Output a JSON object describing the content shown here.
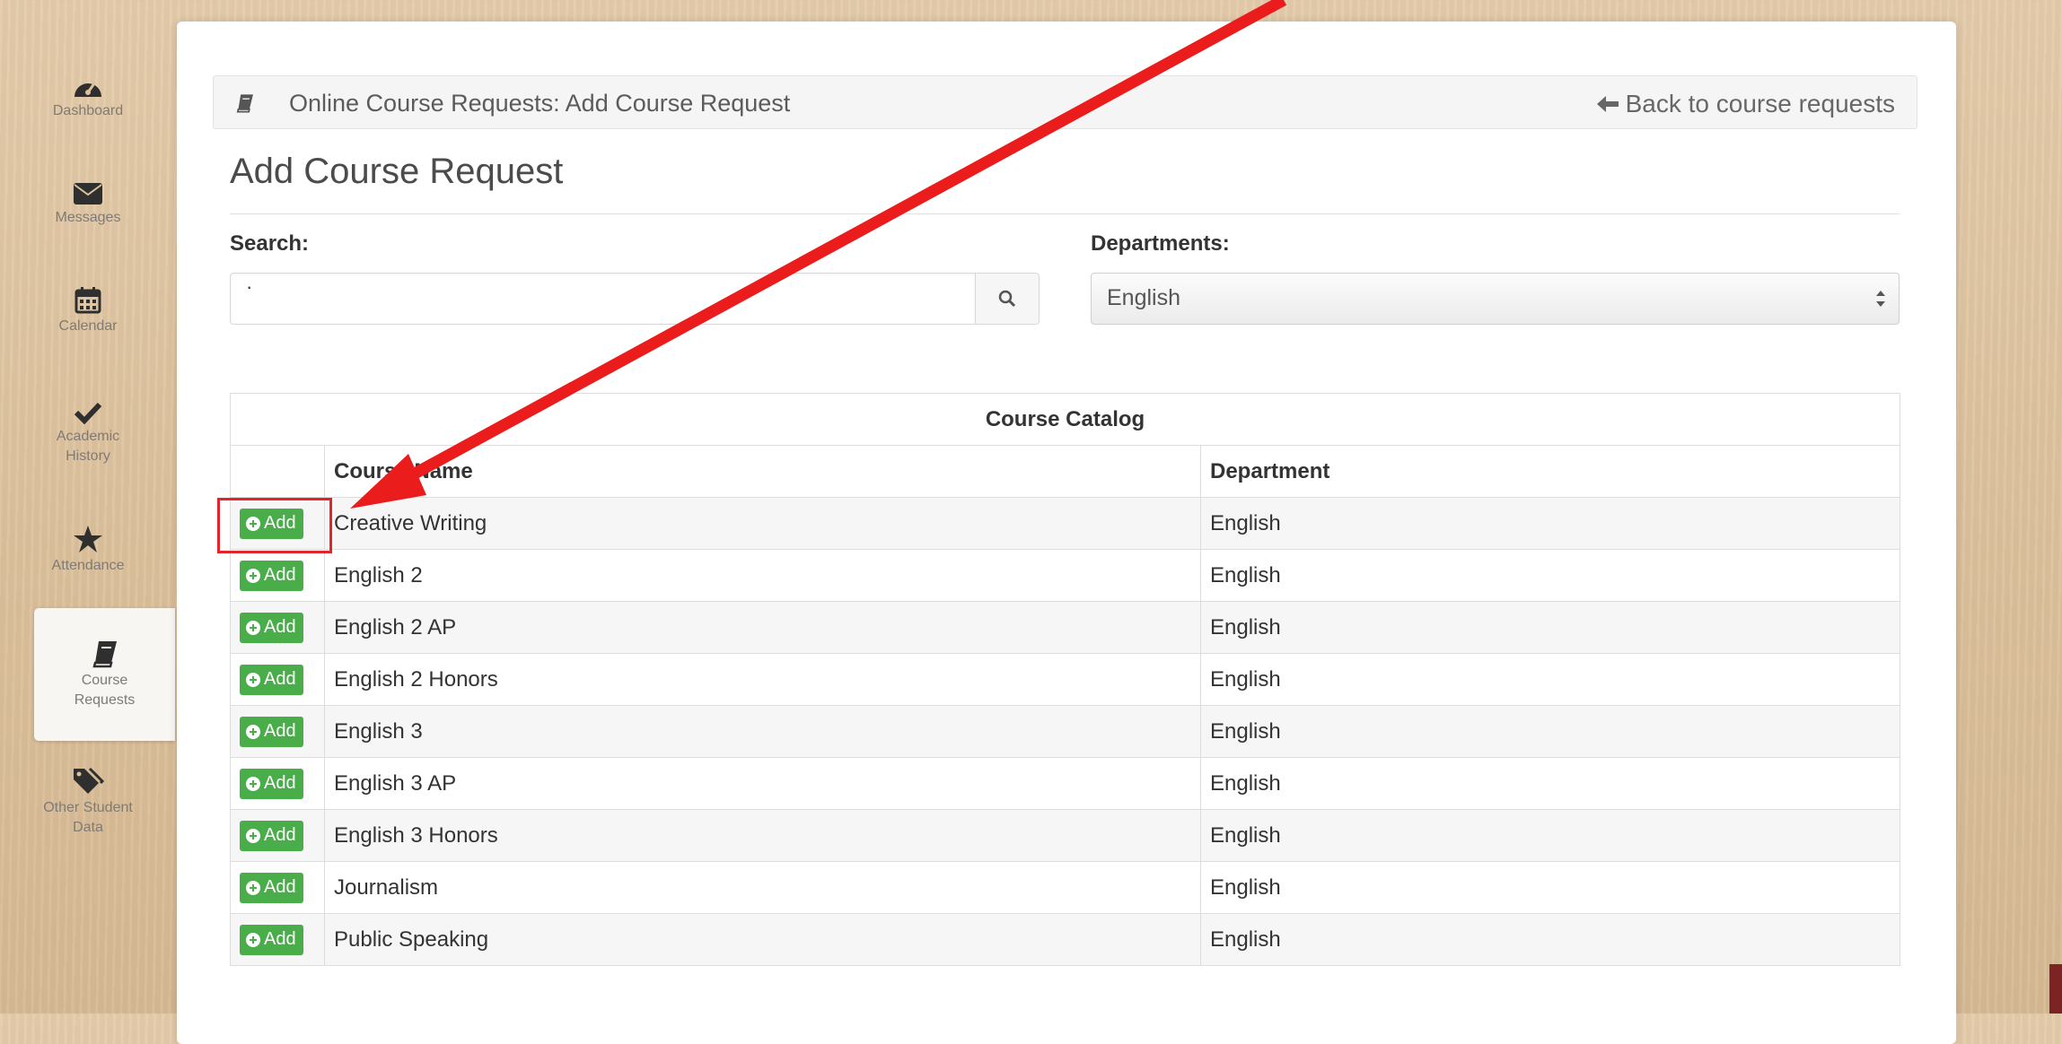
{
  "sidebar": {
    "items": [
      {
        "label": "Dashboard",
        "icon": "dashboard-icon"
      },
      {
        "label": "Messages",
        "icon": "envelope-icon"
      },
      {
        "label": "Calendar",
        "icon": "calendar-icon"
      },
      {
        "label": "Academic History",
        "icon": "checkmark-icon"
      },
      {
        "label": "Attendance",
        "icon": "star-icon"
      },
      {
        "label": "Course Requests",
        "icon": "book-icon",
        "active": true
      },
      {
        "label": "Other Student Data",
        "icon": "tags-icon"
      }
    ]
  },
  "breadcrumb": {
    "icon": "book-icon",
    "title": "Online Course Requests: Add Course Request",
    "back_label": "Back to course requests",
    "back_icon": "arrow-left-icon"
  },
  "page": {
    "title": "Add Course Request"
  },
  "search": {
    "label": "Search:",
    "value": "",
    "placeholder": "",
    "icon": "search-icon"
  },
  "departments": {
    "label": "Departments:",
    "selected": "English"
  },
  "catalog": {
    "caption": "Course Catalog",
    "columns": [
      "Course Name",
      "Department"
    ],
    "add_label": "Add",
    "add_icon": "plus-circle-icon",
    "rows": [
      {
        "name": "Creative Writing",
        "department": "English"
      },
      {
        "name": "English 2",
        "department": "English"
      },
      {
        "name": "English 2 AP",
        "department": "English"
      },
      {
        "name": "English 2 Honors",
        "department": "English"
      },
      {
        "name": "English 3",
        "department": "English"
      },
      {
        "name": "English 3 AP",
        "department": "English"
      },
      {
        "name": "English 3 Honors",
        "department": "English"
      },
      {
        "name": "Journalism",
        "department": "English"
      },
      {
        "name": "Public Speaking",
        "department": "English"
      }
    ]
  },
  "colors": {
    "add_button": "#49ad49",
    "annotation": "#e0262a",
    "background_wood": "#dcc19c"
  }
}
